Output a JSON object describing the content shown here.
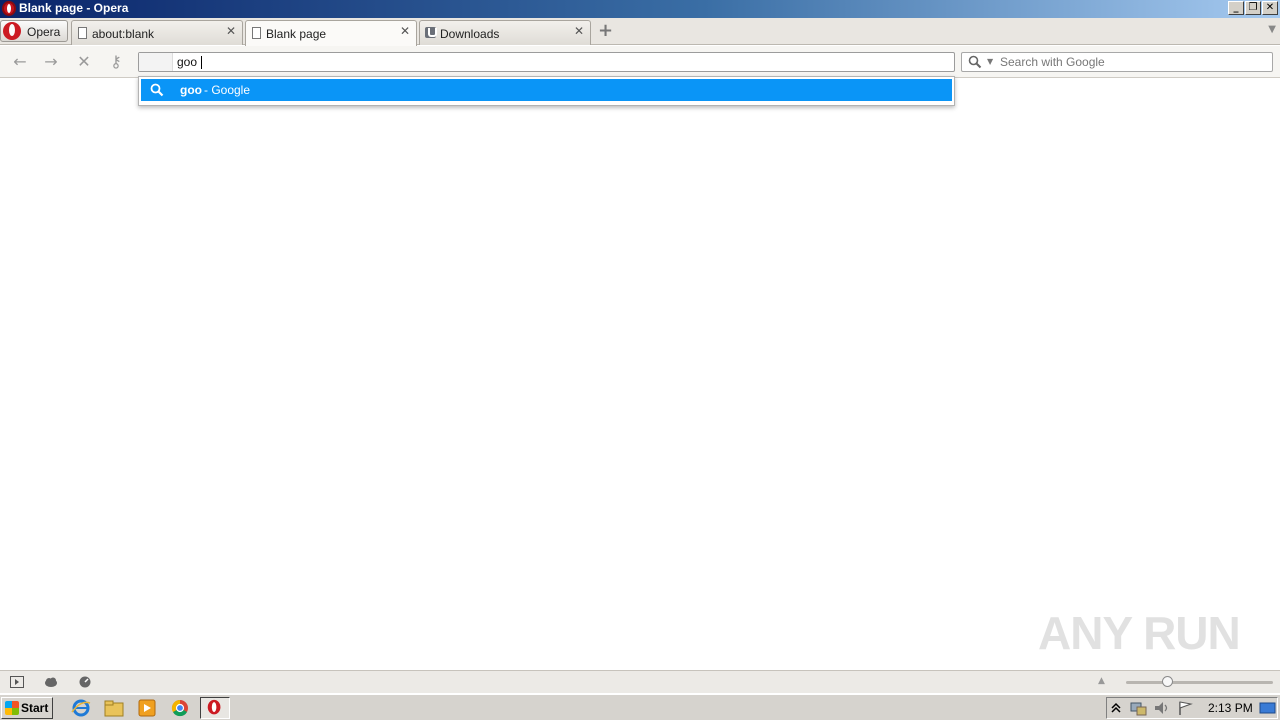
{
  "window": {
    "title": "Blank page - Opera"
  },
  "tabs": {
    "menu_label": "Opera",
    "items": [
      {
        "label": "about:blank",
        "active": false,
        "icon": "page-icon"
      },
      {
        "label": "Blank page",
        "active": true,
        "icon": "page-icon"
      },
      {
        "label": "Downloads",
        "active": false,
        "icon": "downloads-icon"
      }
    ]
  },
  "address_bar": {
    "value": "goo"
  },
  "search_bar": {
    "placeholder": "Search with Google"
  },
  "suggestion": {
    "query": "goo",
    "engine": "- Google"
  },
  "taskbar": {
    "start_label": "Start",
    "clock": "2:13 PM"
  },
  "watermark": "ANY RUN",
  "colors": {
    "accent": "#0a95f7",
    "titlebar": "#0a246a"
  }
}
